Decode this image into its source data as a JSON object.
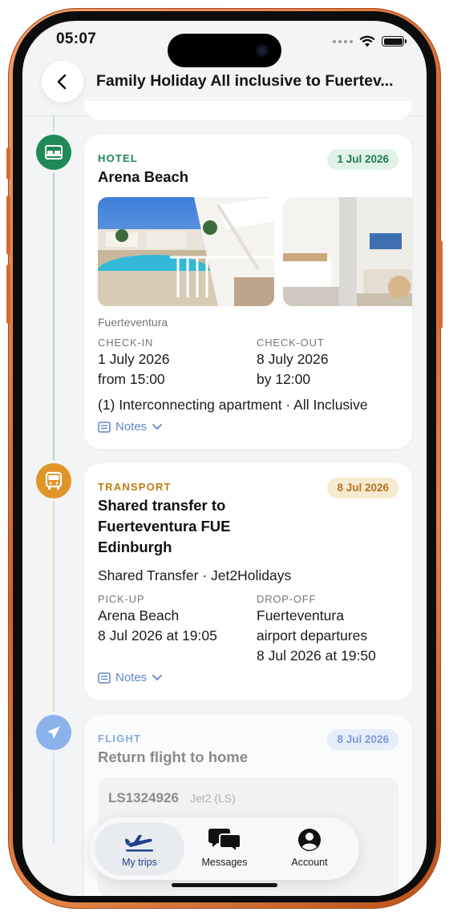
{
  "status_bar": {
    "time": "05:07"
  },
  "header": {
    "title": "Family Holiday All inclusive to Fuertev..."
  },
  "timeline": [
    {
      "type_label": "HOTEL",
      "date": "1 Jul 2026",
      "title": "Arena Beach",
      "location": "Fuerteventura",
      "checkin_label": "CHECK-IN",
      "checkin_date": "1 July 2026",
      "checkin_time": "from 15:00",
      "checkout_label": "CHECK-OUT",
      "checkout_date": "8 July 2026",
      "checkout_time": "by 12:00",
      "room": "(1) Interconnecting apartment · All Inclusive",
      "notes_label": "Notes",
      "color": "#1f8a55"
    },
    {
      "type_label": "TRANSPORT",
      "date": "8 Jul 2026",
      "title_line1": "Shared transfer to",
      "title_line2": "Fuerteventura FUE",
      "title_line3": "Edinburgh",
      "subtitle": "Shared Transfer · Jet2Holidays",
      "pickup_label": "PICK-UP",
      "pickup_place": "Arena Beach",
      "pickup_time": "8 Jul 2026 at 19:05",
      "dropoff_label": "DROP-OFF",
      "dropoff_place_1": "Fuerteventura",
      "dropoff_place_2": "airport departures",
      "dropoff_time": "8 Jul 2026 at 19:50",
      "notes_label": "Notes",
      "color": "#d98a1c"
    },
    {
      "type_label": "FLIGHT",
      "date": "8 Jul 2026",
      "title": "Return flight to home",
      "flight_number": "LS1324926",
      "airline": "Jet2 (LS)",
      "color": "#7ea6e8"
    }
  ],
  "bottom_nav": {
    "items": [
      {
        "label": "My trips",
        "icon": "plane-icon",
        "active": true
      },
      {
        "label": "Messages",
        "icon": "chat-bubbles-icon",
        "active": false
      },
      {
        "label": "Account",
        "icon": "user-circle-icon",
        "active": false
      }
    ]
  }
}
